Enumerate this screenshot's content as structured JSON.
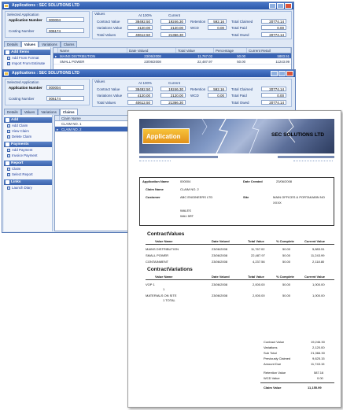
{
  "win1": {
    "title": "Applications : SEC SOLUTIONS LTD",
    "selected_application_label": "Selected Application",
    "application_number_label": "Application Number",
    "application_number": "000004",
    "costing_number_label": "Costing Number",
    "costing_number": "006174",
    "values_label": "Values",
    "at100_label": "At 100%",
    "current_label": "Current",
    "contract_value_label": "Contract Value",
    "contract_value_100": "38492.50",
    "contract_value_current": "19246.30",
    "variations_value_label": "Variations Value",
    "variations_value_100": "4120.00",
    "variations_value_current": "2120.00",
    "total_values_label": "Total Values",
    "total_values_100": "40612.50",
    "total_values_current": "21366.30",
    "retention_label": "Retention",
    "retention": "592.16",
    "wcd_label": "WCD",
    "wcd": "0.00",
    "total_claimed_label": "Total Claimed",
    "total_claimed": "20774.14",
    "total_paid_label": "Total Paid",
    "total_paid": "0.00",
    "total_owed_label": "Total Owed",
    "total_owed": "20774.14",
    "tabs": [
      "Details",
      "Values",
      "Variations",
      "Claims"
    ],
    "sidebar_head": "Add Items",
    "sidebar_items": [
      "Add From Format",
      "Import From Estimate"
    ],
    "grid_headers": [
      "",
      "Name",
      "Date Valued",
      "Total Value",
      "Percentage",
      "Current Retail"
    ],
    "grid_rows": [
      [
        "MAINS DISTRIBUTION",
        "23/06/2008",
        "11,767.02",
        "50.00",
        "5883.51"
      ],
      [
        "SMALL POWER",
        "23/06/2008",
        "22,487.97",
        "50.00",
        "11243.99"
      ]
    ]
  },
  "win2": {
    "title": "Applications : SEC SOLUTIONS LTD",
    "selected_application_label": "Selected Application",
    "application_number_label": "Application Number",
    "application_number": "000004",
    "costing_number_label": "Costing Number",
    "costing_number": "006174",
    "values_label": "Values",
    "at100_label": "At 100%",
    "current_label": "Current",
    "contract_value_label": "Contract Value",
    "contract_value_100": "38492.50",
    "contract_value_current": "19246.30",
    "variations_value_label": "Variations Value",
    "variations_value_100": "4120.00",
    "variations_value_current": "2120.00",
    "total_values_label": "Total Values",
    "total_values_100": "40612.50",
    "total_values_current": "21366.30",
    "retention_label": "Retention",
    "retention": "592.16",
    "wcd_label": "WCD",
    "wcd": "0.00",
    "total_claimed_label": "Total Claimed",
    "total_claimed": "20774.14",
    "total_paid_label": "Total Paid",
    "total_paid": "0.00",
    "total_owed_label": "Total Owed",
    "total_owed": "20774.14",
    "tabs": [
      "Details",
      "Values",
      "Variations",
      "Claims"
    ],
    "sidebar": {
      "add_head": "Add",
      "add_items": [
        "Add Claim",
        "View Claim",
        "Delete Claim"
      ],
      "payments_head": "Payments",
      "payments_items": [
        "Add Payment",
        "Invoice Payment"
      ],
      "report_head": "Report",
      "report_items": [
        "Claim",
        "Select Report"
      ],
      "links_head": "Links",
      "links_items": [
        "Launch Diary"
      ]
    },
    "grid_headers": [
      "",
      "Claim Name"
    ],
    "grid_rows": [
      "CLAIM NO. 1",
      "CLAIM NO. 2"
    ]
  },
  "doc": {
    "banner_title": "Application",
    "company": "SEC SOLUTIONS LTD",
    "application_name_label": "Application Name",
    "application_name": "000004",
    "date_created_label": "Date Created",
    "date_created": "23/06/2008",
    "claim_name_label": "Claim Name",
    "claim_name": "CLAIM NO. 2",
    "customer_label": "Customer",
    "customer": "ABC ENGINEERS LTD",
    "site_label": "Site",
    "site": "MAIN OFFICES & PORTAKABIN NO",
    "site2": "XXXX",
    "wales": "WALES",
    "wales_postcode": "WA1 5RT",
    "contract_title": "ContractValues",
    "col_value_name": "Value Name",
    "col_date_valued": "Date Valued",
    "col_total_value": "Total Value",
    "col_pct": "% Complete",
    "col_current": "Current Value",
    "contract_rows": [
      [
        "MAINS DISTRIBUTION",
        "23/06/2008",
        "11,767.02",
        "50.00",
        "5,883.51"
      ],
      [
        "SMALL POWER",
        "23/06/2008",
        "22,487.97",
        "50.00",
        "11,243.99"
      ],
      [
        "CONTAINMENT",
        "23/06/2008",
        "4,237.56",
        "50.00",
        "2,118.80"
      ]
    ],
    "variations_title": "ContractVariations",
    "variation_rows": [
      [
        "VOP 1",
        "23/06/2008",
        "2,000.00",
        "50.00",
        "1,000.00"
      ],
      [
        "MATERIALS ON SITE",
        "23/06/2008",
        "2,000.00",
        "50.00",
        "1,000.00"
      ]
    ],
    "variation_subs": [
      "1",
      "1 TOTAL"
    ],
    "totals": [
      [
        "Contract Value",
        "19,246.30"
      ],
      [
        "Variations",
        "2,120.00"
      ],
      [
        "Sub Total",
        "21,366.30"
      ],
      [
        "Previously Claimed",
        "9,625.15"
      ],
      [
        "Amount Due",
        "11,743.15"
      ],
      [
        "Retention Value",
        "587.16"
      ],
      [
        "WCD Value",
        "0.00"
      ]
    ],
    "claim_value_label": "Claim Value",
    "claim_value": "11,155.99"
  }
}
